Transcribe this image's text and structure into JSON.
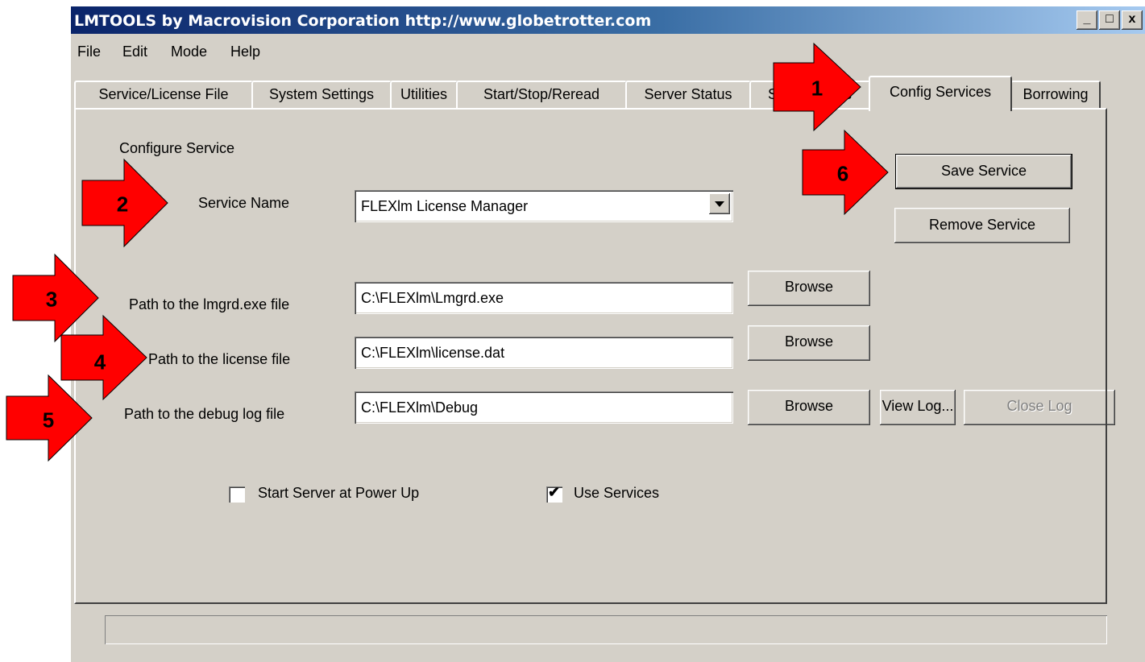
{
  "window": {
    "title": "LMTOOLS by Macrovision Corporation http://www.globetrotter.com"
  },
  "window_controls": {
    "minimize": "_",
    "maximize": "□",
    "close": "x"
  },
  "menu": [
    "File",
    "Edit",
    "Mode",
    "Help"
  ],
  "tabs": [
    "Service/License File",
    "System Settings",
    "Utilities",
    "Start/Stop/Reread",
    "Server Status",
    "Server Diags",
    "Config Services",
    "Borrowing"
  ],
  "active_tab": "Config Services",
  "config": {
    "section_title": "Configure Service",
    "service_name_label": "Service Name",
    "service_name_value": "FLEXlm License Manager",
    "lmgrd_label": "Path to the lmgrd.exe file",
    "lmgrd_value": "C:\\FLEXlm\\Lmgrd.exe",
    "license_label": "Path to the license file",
    "license_value": "C:\\FLEXlm\\license.dat",
    "debug_label": "Path to the debug log file",
    "debug_value": "C:\\FLEXlm\\Debug",
    "browse": "Browse",
    "view_log": "View Log...",
    "close_log": "Close Log",
    "save_service": "Save Service",
    "remove_service": "Remove Service",
    "start_at_power_up_label": "Start Server at Power Up",
    "start_at_power_up_checked": false,
    "use_services_label": "Use Services",
    "use_services_checked": true
  },
  "status_bar": {
    "text": ""
  },
  "callouts": [
    "1",
    "2",
    "3",
    "4",
    "5",
    "6"
  ],
  "colors": {
    "arrow_fill": "#ff0000",
    "titlebar_start": "#0a246a",
    "titlebar_end": "#a6caf0",
    "face": "#d4d0c8"
  }
}
